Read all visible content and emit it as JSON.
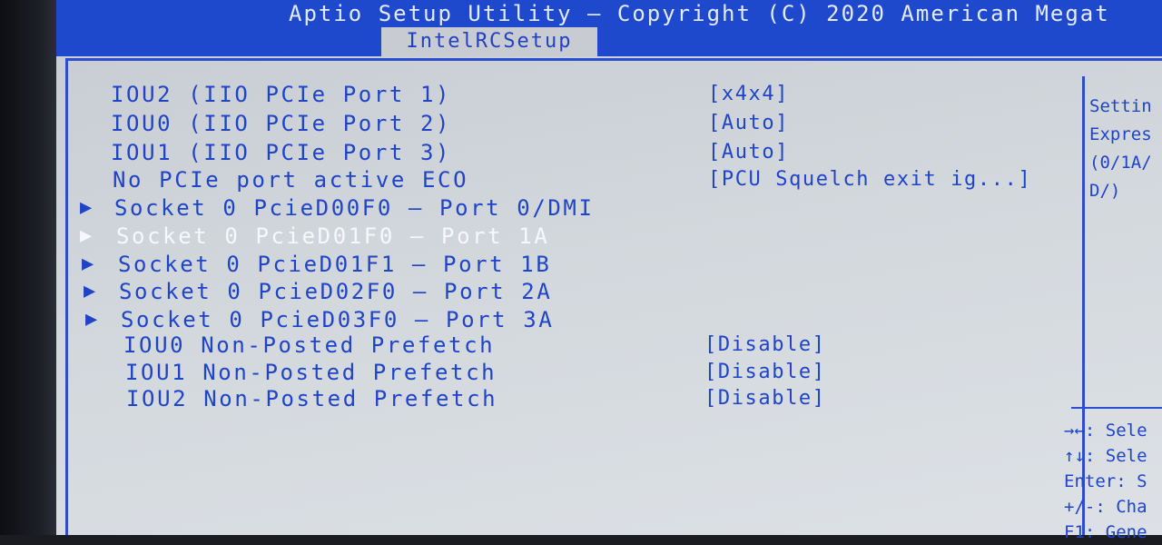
{
  "header": {
    "title": "Aptio Setup Utility – Copyright (C) 2020 American Megat",
    "active_tab": "IntelRCSetup"
  },
  "menu": [
    {
      "label": "IOU2 (IIO PCIe Port 1)",
      "value": "[x4x4]",
      "submenu": false,
      "selected": false
    },
    {
      "label": "IOU0 (IIO PCIe Port 2)",
      "value": "[Auto]",
      "submenu": false,
      "selected": false
    },
    {
      "label": "IOU1 (IIO PCIe Port 3)",
      "value": "[Auto]",
      "submenu": false,
      "selected": false
    },
    {
      "label": "No PCIe port active ECO",
      "value": "[PCU Squelch exit ig...]",
      "submenu": false,
      "selected": false
    },
    {
      "label": "Socket 0 PcieD00F0 – Port 0/DMI",
      "value": "",
      "submenu": true,
      "selected": false
    },
    {
      "label": "Socket 0 PcieD01F0 – Port 1A",
      "value": "",
      "submenu": true,
      "selected": true
    },
    {
      "label": "Socket 0 PcieD01F1 – Port 1B",
      "value": "",
      "submenu": true,
      "selected": false
    },
    {
      "label": "Socket 0 PcieD02F0 – Port 2A",
      "value": "",
      "submenu": true,
      "selected": false
    },
    {
      "label": "Socket 0 PcieD03F0 – Port 3A",
      "value": "",
      "submenu": true,
      "selected": false
    },
    {
      "label": "IOU0 Non-Posted Prefetch",
      "value": "[Disable]",
      "submenu": false,
      "selected": false
    },
    {
      "label": "IOU1 Non-Posted Prefetch",
      "value": "[Disable]",
      "submenu": false,
      "selected": false
    },
    {
      "label": "IOU2 Non-Posted Prefetch",
      "value": "[Disable]",
      "submenu": false,
      "selected": false
    }
  ],
  "submenu_arrow": "▶",
  "help_panel": {
    "lines": [
      "Settin",
      "Expres",
      "(0/1A/",
      "D/)"
    ]
  },
  "key_legend": {
    "lines": [
      "→←: Sele",
      "↑↓: Sele",
      "Enter: S",
      "+/-: Cha",
      "F1: Gene"
    ]
  },
  "colors": {
    "header_bg": "#1f49cc",
    "text": "#1f44c6",
    "selected_text": "#f6f8fc",
    "panel_bg": "#d3d8dd"
  }
}
